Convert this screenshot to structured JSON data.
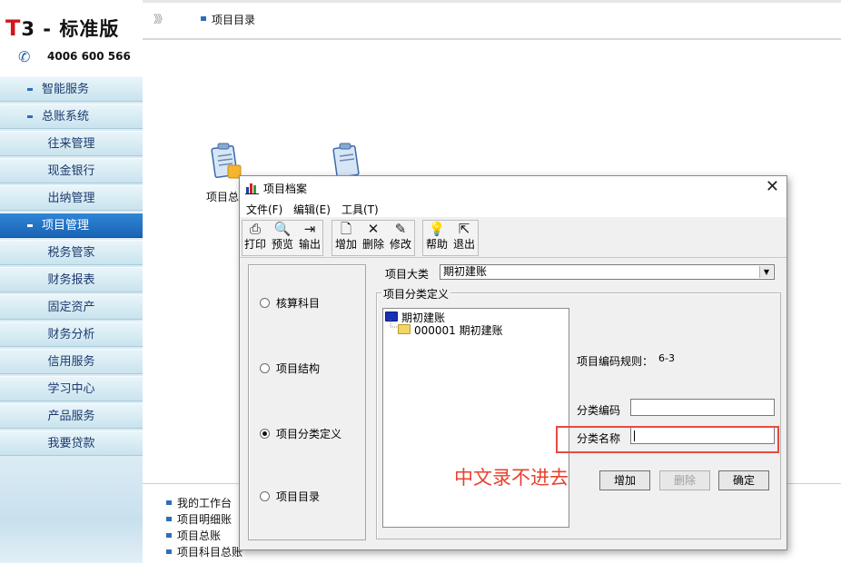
{
  "brand": {
    "logo_letter": "T",
    "logo_rest": "3 - 标准版",
    "phone": "4006 600 566"
  },
  "sidebar": {
    "items": [
      {
        "label": "智能服务"
      },
      {
        "label": "总账系统"
      },
      {
        "label": "往来管理"
      },
      {
        "label": "现金银行"
      },
      {
        "label": "出纳管理"
      },
      {
        "label": "项目管理"
      },
      {
        "label": "税务管家"
      },
      {
        "label": "财务报表"
      },
      {
        "label": "固定资产"
      },
      {
        "label": "财务分析"
      },
      {
        "label": "信用服务"
      },
      {
        "label": "学习中心"
      },
      {
        "label": "产品服务"
      },
      {
        "label": "我要贷款"
      }
    ]
  },
  "topbar": {
    "arrows": "》》",
    "breadcrumb": "项目目录"
  },
  "workspace": {
    "icon1_label": "项目总"
  },
  "bottom_links": [
    "我的工作台",
    "项目明细账",
    "项目总账",
    "项目科目总账"
  ],
  "dialog": {
    "title": "项目档案",
    "close": "✕",
    "menu": [
      "文件(F)",
      "编辑(E)",
      "工具(T)"
    ],
    "toolbar": {
      "print": "打印",
      "preview": "预览",
      "export": "输出",
      "add": "增加",
      "delete": "删除",
      "modify": "修改",
      "help": "帮助",
      "exit": "退出"
    },
    "radios": [
      {
        "label": "核算科目",
        "checked": false
      },
      {
        "label": "项目结构",
        "checked": false
      },
      {
        "label": "项目分类定义",
        "checked": true
      },
      {
        "label": "项目目录",
        "checked": false
      }
    ],
    "category_label": "项目大类",
    "category_value": "期初建账",
    "group_legend": "项目分类定义",
    "tree": {
      "root": "期初建账",
      "child": "000001  期初建账"
    },
    "rule_label": "项目编码规则：",
    "rule_value": "6-3",
    "code_label": "分类编码",
    "code_value": "",
    "name_label": "分类名称",
    "name_value": "",
    "annotation": "中文录不进去",
    "buttons": {
      "add": "增加",
      "delete": "删除",
      "ok": "确定"
    },
    "colors": {
      "folder_root": "#1633b5",
      "folder_child": "#f2d565",
      "annotation": "#e8412f",
      "active_nav": "#1f6fc4"
    }
  }
}
